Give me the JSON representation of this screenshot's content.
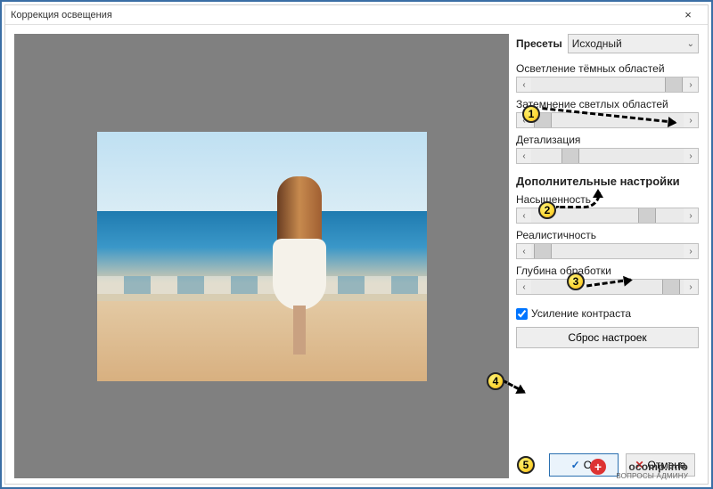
{
  "window": {
    "title": "Коррекция освещения",
    "close_label": "×"
  },
  "presets": {
    "label": "Пресеты",
    "selected": "Исходный"
  },
  "sliders": {
    "lighten": {
      "label": "Осветление тёмных областей",
      "pos": 88
    },
    "darken": {
      "label": "Затемнение светлых областей",
      "pos": 2
    },
    "detail": {
      "label": "Детализация",
      "pos": 20
    },
    "saturation": {
      "label": "Насыщенность",
      "pos": 70
    },
    "realism": {
      "label": "Реалистичность",
      "pos": 2
    },
    "depth": {
      "label": "Глубина обработки",
      "pos": 86
    }
  },
  "section_additional": "Дополнительные настройки",
  "contrast": {
    "label": "Усиление контраста",
    "checked": true
  },
  "reset_label": "Сброс настроек",
  "buttons": {
    "ok": "Ок",
    "cancel": "Отмена"
  },
  "callouts": {
    "c1": "1",
    "c2": "2",
    "c3": "3",
    "c4": "4",
    "c5": "5"
  },
  "watermark": {
    "line1": "ocomp.info",
    "line2": "ВОПРОСЫ АДМИНУ"
  }
}
